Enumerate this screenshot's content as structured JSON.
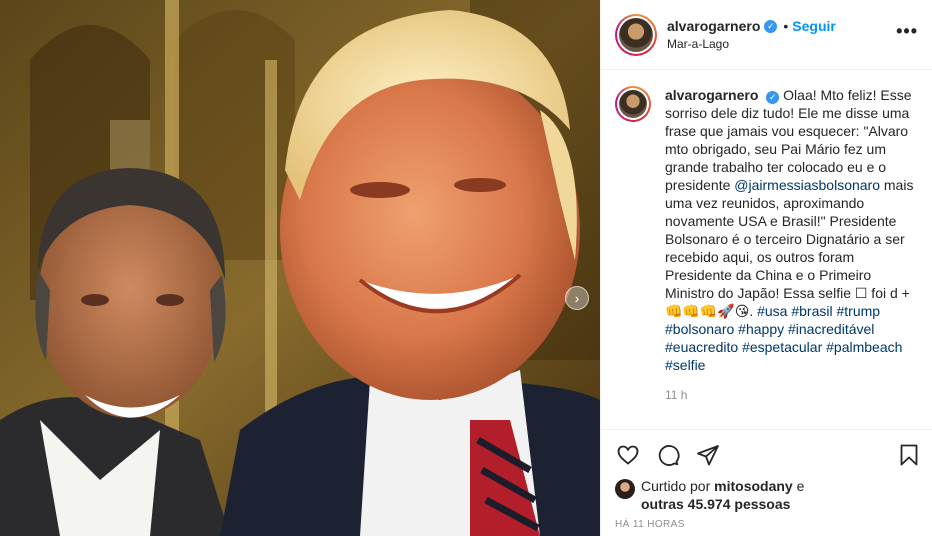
{
  "post": {
    "photo_alt": "",
    "carousel_next": "›"
  },
  "header": {
    "username": "alvarogarnero",
    "verified_glyph": "✓",
    "dot": "•",
    "follow_label": "Seguir",
    "location": "Mar-a-Lago",
    "more_label": "•••"
  },
  "caption": {
    "username": "alvarogarnero",
    "verified_glyph": "✓",
    "text_1": " Olaa! Mto feliz! Esse sorriso dele diz tudo! Ele me disse uma frase que jamais vou esquecer: \"Alvaro mto obrigado, seu Pai Mário fez um grande trabalho ter colocado eu e o presidente ",
    "mention": "@jairmessiasbolsonaro",
    "text_2": " mais uma vez reunidos, aproximando novamente USA e Brasil!\" Presidente Bolsonaro é o terceiro Dignatário a ser recebido aqui, os outros foram Presidente da China e o Primeiro Ministro do Japão! Essa selfie ☐ foi d + 👊👊👊🚀😘. ",
    "hashtags": [
      "#usa",
      "#brasil",
      "#trump",
      "#bolsonaro",
      "#happy",
      "#inacreditável",
      "#euacredito",
      "#espetacular",
      "#palmbeach",
      "#selfie"
    ],
    "time": "11 h"
  },
  "actions": {
    "like_icon": "heart-icon",
    "comment_icon": "comment-icon",
    "share_icon": "share-icon",
    "save_icon": "bookmark-icon"
  },
  "likes": {
    "prefix": "Curtido por ",
    "liker": "mitosodany",
    "middle": " e",
    "others": "outras 45.974 pessoas"
  },
  "timestamp": "HÁ 11 HORAS"
}
